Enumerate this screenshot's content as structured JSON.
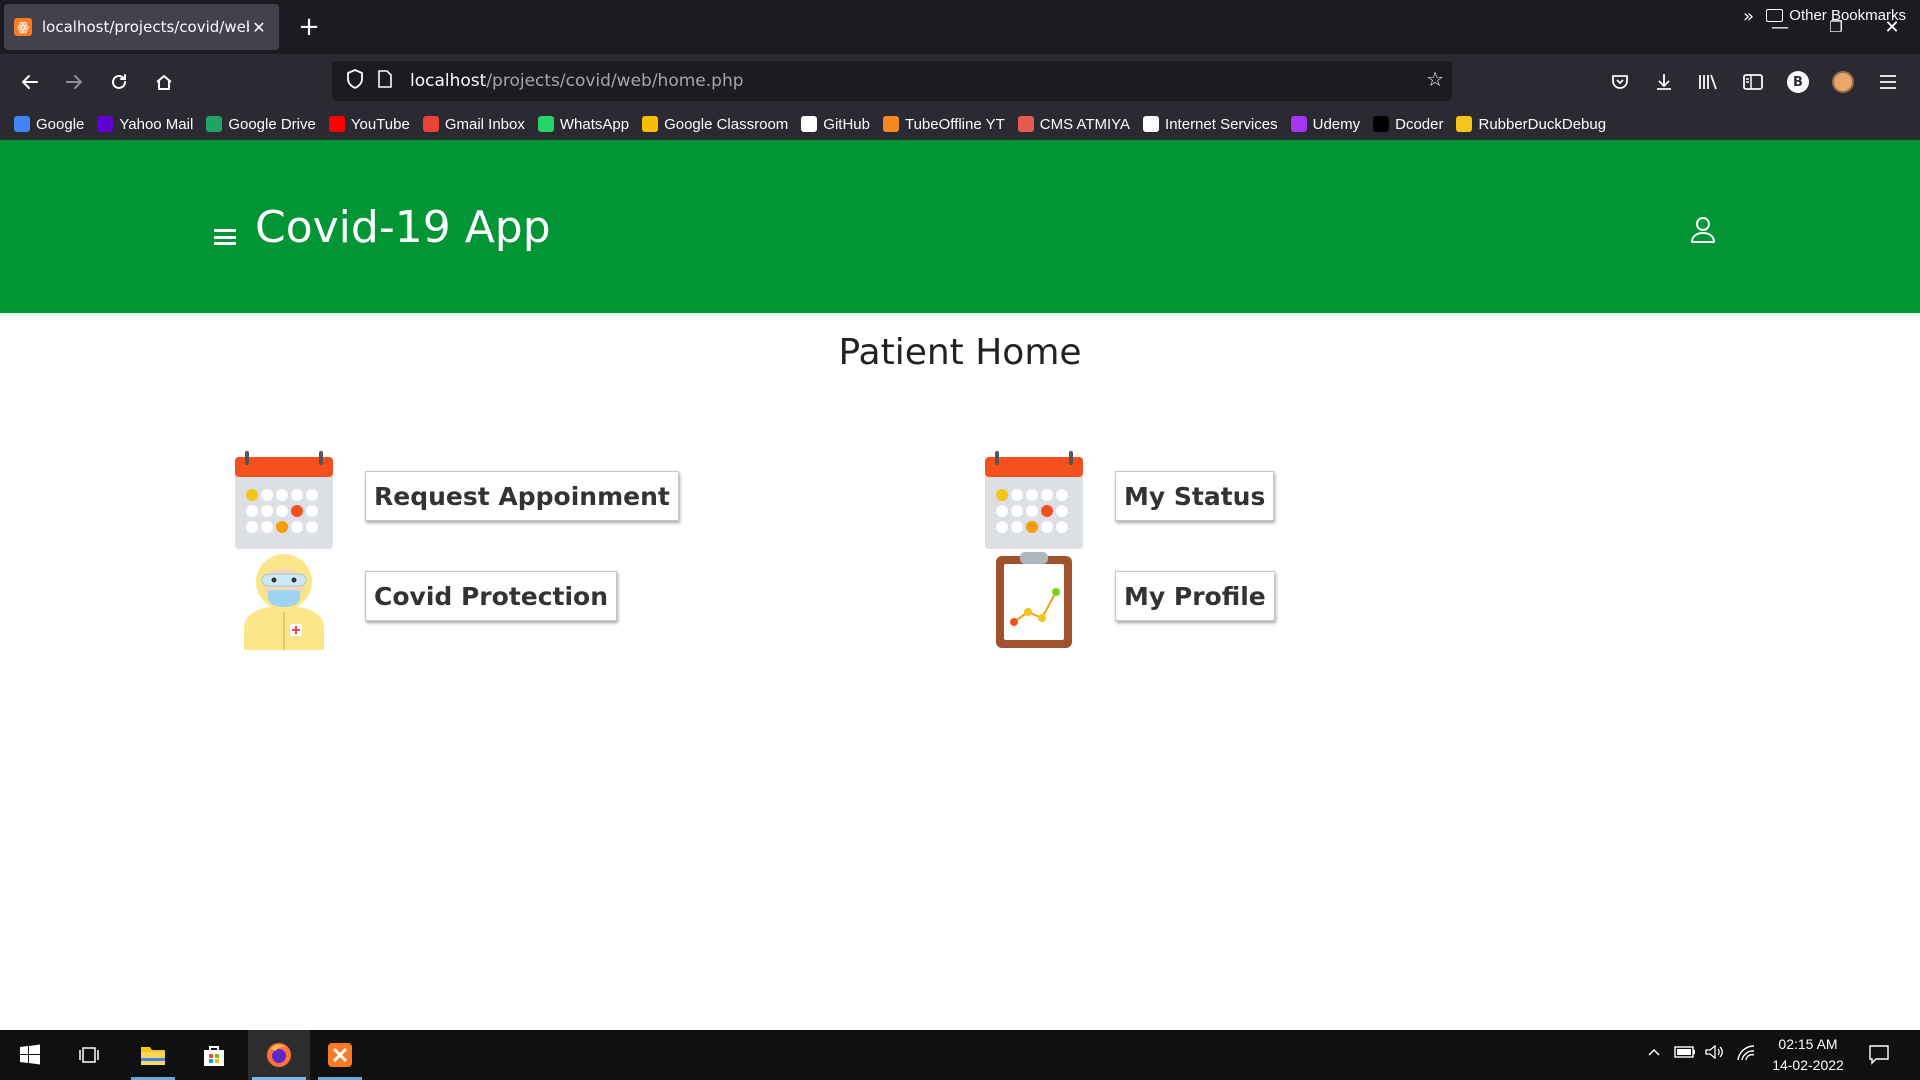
{
  "browser": {
    "tab_title": "localhost/projects/covid/web/h",
    "url_host": "localhost",
    "url_path": "/projects/covid/web/home.php",
    "bookmarks": [
      {
        "label": "Google",
        "color": "#4285f4"
      },
      {
        "label": "Yahoo Mail",
        "color": "#6001d2"
      },
      {
        "label": "Google Drive",
        "color": "#1fa463"
      },
      {
        "label": "YouTube",
        "color": "#ff0000"
      },
      {
        "label": "Gmail Inbox",
        "color": "#ea4335"
      },
      {
        "label": "WhatsApp",
        "color": "#25d366"
      },
      {
        "label": "Google Classroom",
        "color": "#f9bc05"
      },
      {
        "label": "GitHub",
        "color": "#ffffff"
      },
      {
        "label": "TubeOffline YT",
        "color": "#f48a1f"
      },
      {
        "label": "CMS ATMIYA",
        "color": "#e85a4f"
      },
      {
        "label": "Internet Services",
        "color": "#fbfbfe"
      },
      {
        "label": "Udemy",
        "color": "#a435f0"
      },
      {
        "label": "Dcoder",
        "color": "#000000"
      },
      {
        "label": "RubberDuckDebug",
        "color": "#f5c518"
      }
    ],
    "other_bookmarks": "Other Bookmarks"
  },
  "app": {
    "title": "Covid-19 App",
    "header_color": "#019535",
    "page_title": "Patient Home",
    "actions": [
      {
        "label": "Request Appoinment",
        "icon": "calendar-icon"
      },
      {
        "label": "My Status",
        "icon": "calendar-icon"
      },
      {
        "label": "Covid Protection",
        "icon": "ppe-doctor-icon"
      },
      {
        "label": "My Profile",
        "icon": "clipboard-chart-icon"
      }
    ]
  },
  "taskbar": {
    "time": "02:15 AM",
    "date": "14-02-2022"
  }
}
